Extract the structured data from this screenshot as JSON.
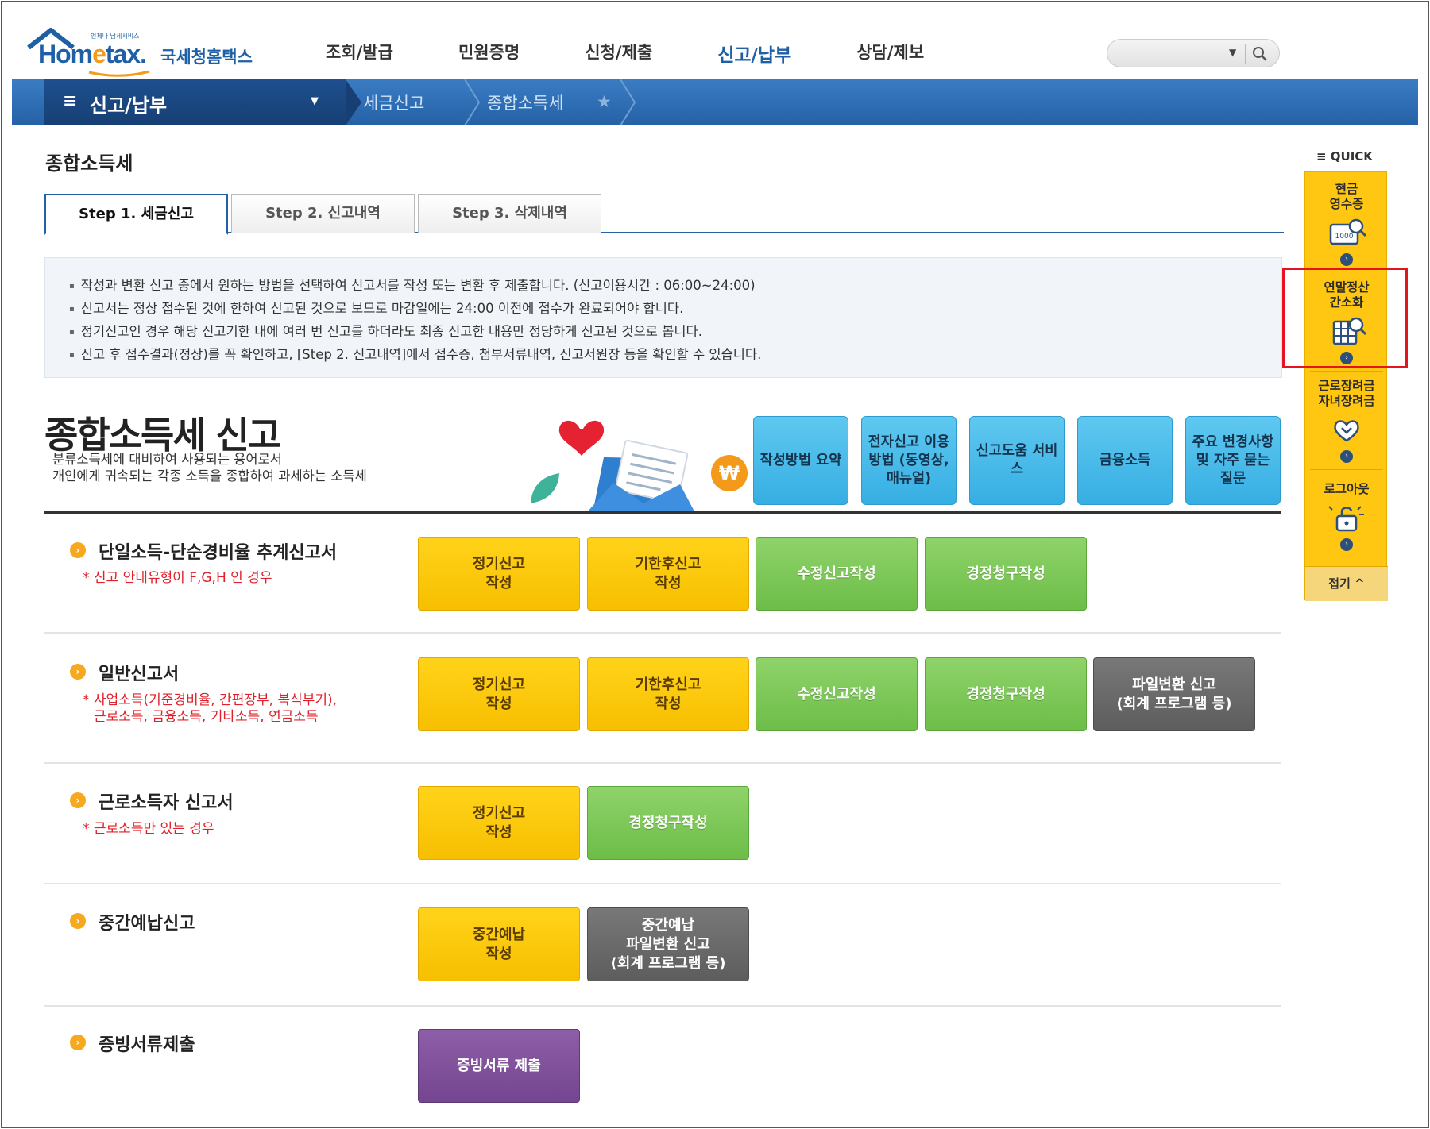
{
  "header": {
    "logo_small": "언제나 납세서비스",
    "logo_word_1": "Hom",
    "logo_word_e": "e",
    "logo_word_2": "tax.",
    "logo_kr": "국세청홈택스",
    "nav": [
      "조회/발급",
      "민원증명",
      "신청/제출",
      "신고/납부",
      "상담/제보"
    ],
    "search_placeholder": ""
  },
  "breadcrumb": {
    "menu_icon": "≡",
    "title": "신고/납부",
    "items": [
      "세금신고",
      "종합소득세"
    ]
  },
  "page_title": "종합소득세",
  "tabs": [
    "Step 1. 세금신고",
    "Step 2. 신고내역",
    "Step 3. 삭제내역"
  ],
  "notice": [
    "작성과 변환 신고 중에서 원하는 방법을 선택하여 신고서를 작성 또는 변환 후 제출합니다. (신고이용시간 : 06:00~24:00)",
    "신고서는 정상 접수된 것에 한하여 신고된 것으로 보므로 마감일에는 24:00 이전에 접수가 완료되어야 합니다.",
    "정기신고인 경우 해당 신고기한 내에 여러 번 신고를 하더라도 최종 신고한 내용만 정당하게 신고된 것으로 봅니다.",
    "신고 후 접수결과(정상)를 꼭 확인하고, [Step 2. 신고내역]에서 접수증, 첨부서류내역, 신고서원장 등을 확인할 수 있습니다."
  ],
  "hero": {
    "title": "종합소득세 신고",
    "desc_1": "분류소득세에 대비하여 사용되는 용어로서",
    "desc_2": "개인에게 귀속되는 각종 소득을 종합하여 과세하는 소득세",
    "coin_symbol": "₩"
  },
  "help_buttons": [
    "작성방법 요약",
    "전자신고 이용방법 (동영상, 매뉴얼)",
    "신고도움 서비스",
    "금융소득",
    "주요 변경사항 및 자주 묻는 질문"
  ],
  "sections": [
    {
      "title": "단일소득-단순경비율 추계신고서",
      "note_1": "* 신고 안내유형이 F,G,H 인 경우",
      "note_2": "",
      "buttons": [
        "정기신고\n작성",
        "기한후신고\n작성",
        "수정신고작성",
        "경정청구작성"
      ]
    },
    {
      "title": "일반신고서",
      "note_1": "* 사업소득(기준경비율, 간편장부, 복식부기),",
      "note_2": "근로소득, 금융소득, 기타소득, 연금소득",
      "buttons": [
        "정기신고\n작성",
        "기한후신고\n작성",
        "수정신고작성",
        "경정청구작성",
        "파일변환 신고\n(회계 프로그램 등)"
      ]
    },
    {
      "title": "근로소득자 신고서",
      "note_1": "* 근로소득만 있는 경우",
      "note_2": "",
      "buttons": [
        "정기신고\n작성",
        "경정청구작성"
      ]
    },
    {
      "title": "중간예납신고",
      "note_1": "",
      "note_2": "",
      "buttons": [
        "중간예납\n작성",
        "중간예납\n파일변환 신고\n(회계 프로그램 등)"
      ]
    },
    {
      "title": "증빙서류제출",
      "note_1": "",
      "note_2": "",
      "buttons": [
        "증빙서류 제출"
      ]
    }
  ],
  "quick": {
    "label": "≡ QUICK",
    "items": [
      {
        "label": "현금\n영수증",
        "icon": "receipt-icon"
      },
      {
        "label": "연말정산\n간소화",
        "icon": "calculator-search-icon"
      },
      {
        "label": "근로장려금\n자녀장려금",
        "icon": "heart-hands-icon"
      },
      {
        "label": "로그아웃",
        "icon": "unlock-icon"
      }
    ],
    "fold": "접기 ^",
    "arrow": "›",
    "receipt_value": "1000"
  },
  "colors": {
    "brand_blue": "#1f5fa5",
    "accent_orange": "#f39a1b",
    "yellow": "#ffc612",
    "green": "#6dbd48",
    "gray": "#5d5d5d",
    "purple": "#744590",
    "highlight": "#e4151f"
  }
}
